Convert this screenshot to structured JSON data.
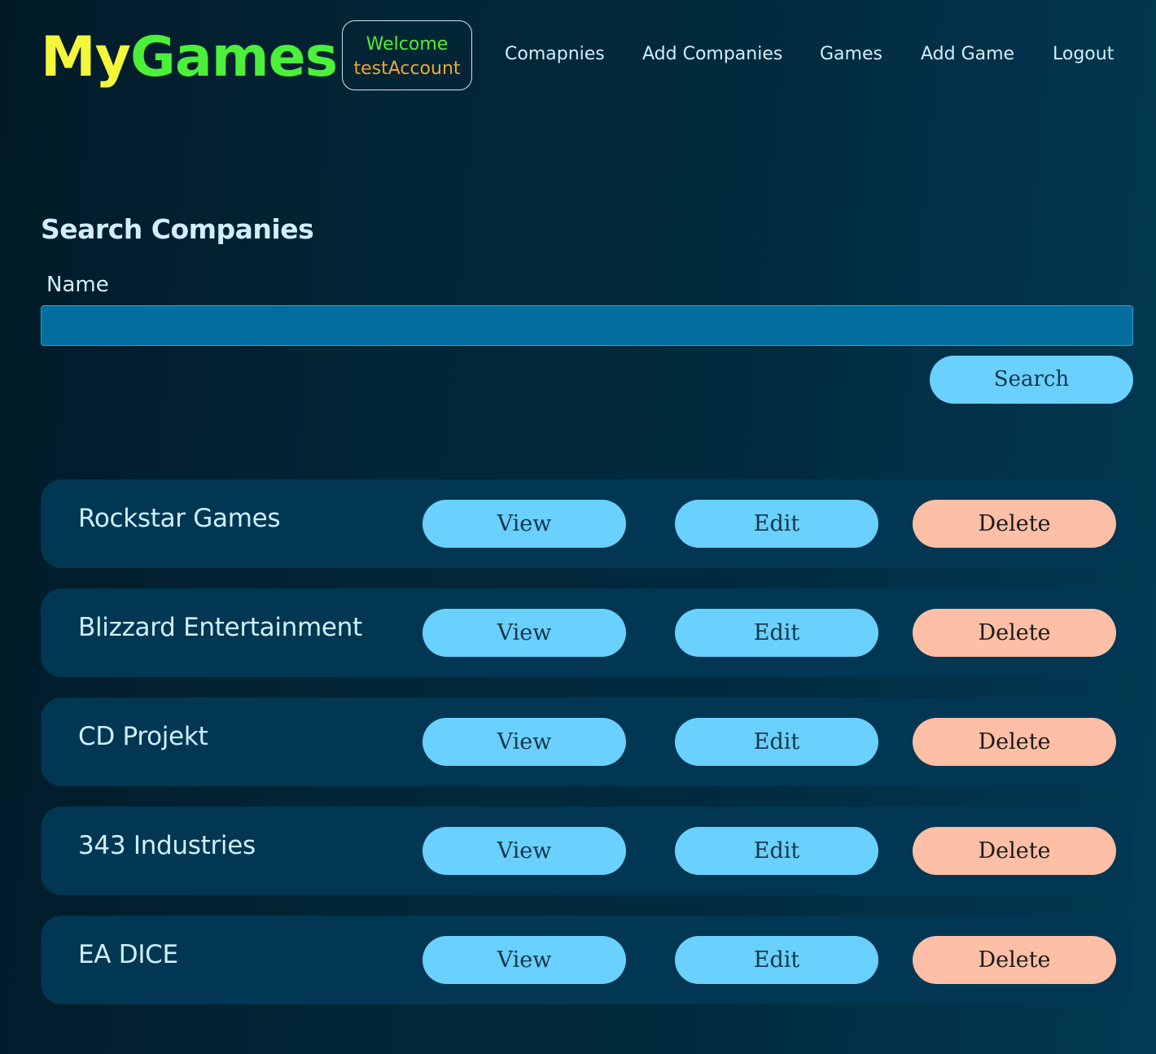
{
  "header": {
    "logo_part1": "My",
    "logo_part2": "Games",
    "welcome_line1": "Welcome",
    "welcome_line2": "testAccount",
    "nav": [
      "Comapnies",
      "Add Companies",
      "Games",
      "Add Game",
      "Logout"
    ]
  },
  "search": {
    "title": "Search Companies",
    "name_label": "Name",
    "name_value": "",
    "button_label": "Search"
  },
  "companies": [
    {
      "name": "Rockstar Games"
    },
    {
      "name": "Blizzard Entertainment"
    },
    {
      "name": "CD Projekt"
    },
    {
      "name": "343 Industries"
    },
    {
      "name": "EA DICE"
    }
  ],
  "row_actions": {
    "view": "View",
    "edit": "Edit",
    "delete": "Delete"
  },
  "colors": {
    "logo_my": "#f3f63a",
    "logo_games": "#4cf03a",
    "welcome_user": "#f0a438",
    "primary_button": "#6ad0fe",
    "delete_button": "#fdbfa5",
    "row_background": "#013752",
    "input_background": "#036e9e"
  }
}
